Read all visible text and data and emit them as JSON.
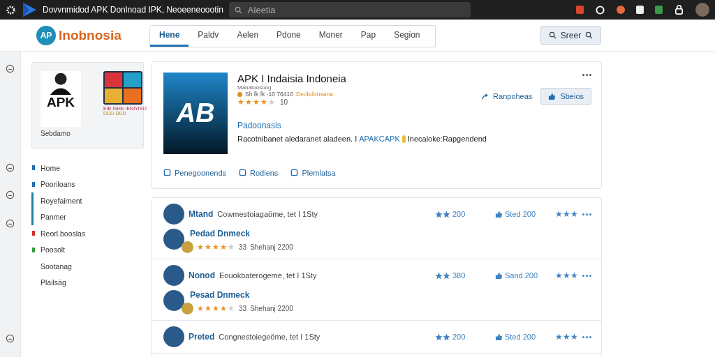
{
  "browser": {
    "title": "Dovvnmidod APK Donlnoad IPK, Neoeeneoootin",
    "address": "Aleetia"
  },
  "header": {
    "logo_mark": "AP",
    "logo_text": "Inobnosia",
    "search_button": "Sreer"
  },
  "tabs": [
    {
      "label": "Hene",
      "selected": true
    },
    {
      "label": "Paldv",
      "selected": false
    },
    {
      "label": "Aelen",
      "selected": false
    },
    {
      "label": "Pdone",
      "selected": false
    },
    {
      "label": "Moner",
      "selected": false
    },
    {
      "label": "Pap",
      "selected": false
    },
    {
      "label": "Segion",
      "selected": false
    }
  ],
  "promo": {
    "apk_label": "APK",
    "line_1": "EIB ISHE IENIYISO",
    "line_2": "DDD·DDD",
    "caption": "Sebdamo"
  },
  "sidebar": {
    "items": [
      {
        "label": "Home",
        "color": "#1f6fb2",
        "selected": false
      },
      {
        "label": "Pooriloans",
        "color": "#1f6fb2",
        "selected": false
      },
      {
        "label": "Royefairnent",
        "selected": true
      },
      {
        "label": "Panmer",
        "selected": true
      },
      {
        "label": "Reorl.booslas",
        "color": "#d12c2c",
        "selected": false
      },
      {
        "label": "Poosolt",
        "color": "#2e9a3a",
        "selected": false
      },
      {
        "label": "Sootanag",
        "selected": false
      },
      {
        "label": "Plailsäg",
        "selected": false
      }
    ]
  },
  "app": {
    "icon_text": "AB",
    "title": "APK I Indaisia Indoneia",
    "subtitle": "Manatoosoog",
    "meta": "Sh fk fk ·10 76410",
    "meta_link": "Deobdonsana",
    "stars": 4,
    "rating_count": "10",
    "share_link": "Ranpoheas",
    "save_button": "Sbeios",
    "section_title": "Padoonasis",
    "desc_start": "Racotnibanet aledaranet aladeen. I",
    "desc_link": "APAKCAPK",
    "desc_end": "Inecaioke:Rapgendend",
    "actions": [
      "Penegoonends",
      "Rodiens",
      "Plemlatsa"
    ]
  },
  "reviews": [
    {
      "name": "Mtand",
      "text": "Cowmestoiagaöme, tet I 1Sty",
      "likes": "200",
      "stat": "Sted 200",
      "stars": 3,
      "reply": {
        "name": "Pedad Dnmeck",
        "stars": 4,
        "count": "33",
        "date": "Shehanj 2200"
      }
    },
    {
      "name": "Nonod",
      "text": "Eouokbaterogeme, tet I 1Sty",
      "likes": "380",
      "stat": "Sand 200",
      "stars": 3,
      "reply": {
        "name": "Pesad Dnmeck",
        "stars": 4,
        "count": "33",
        "date": "Shehanj 2200"
      }
    },
    {
      "name": "Preted",
      "text": "Congnestoiegeöme, tet I 1Sty",
      "likes": "200",
      "stat": "Sted 200",
      "stars": 3
    }
  ]
}
